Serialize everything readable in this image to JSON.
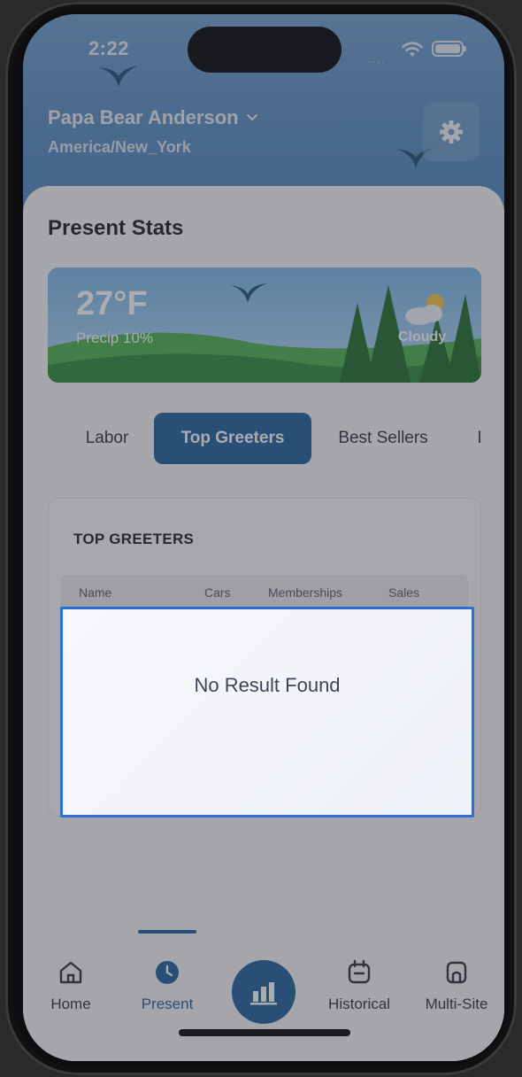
{
  "status_bar": {
    "time": "2:22",
    "dots": "....",
    "icons": [
      "wifi-icon",
      "battery-icon"
    ]
  },
  "header": {
    "user_name": "Papa Bear Anderson",
    "timezone": "America/New_York",
    "settings_icon": "gear-icon"
  },
  "page": {
    "title": "Present Stats"
  },
  "weather": {
    "temperature": "27°F",
    "precip": "Precip 10%",
    "condition": "Cloudy"
  },
  "tabs": [
    {
      "label": "Labor",
      "active": false
    },
    {
      "label": "Top Greeters",
      "active": true
    },
    {
      "label": "Best Sellers",
      "active": false
    },
    {
      "label": "I",
      "active": false
    }
  ],
  "greeters": {
    "title": "TOP GREETERS",
    "columns": [
      "Name",
      "Cars",
      "Memberships",
      "Sales"
    ]
  },
  "modal": {
    "message": "No Result Found"
  },
  "bottom_nav": {
    "items": [
      {
        "label": "Home",
        "icon": "home-icon"
      },
      {
        "label": "Present",
        "icon": "clock-icon",
        "active": true
      },
      {
        "label": "Historical",
        "icon": "calendar-icon"
      },
      {
        "label": "Multi-Site",
        "icon": "store-icon"
      }
    ],
    "center_icon": "bar-chart-icon"
  },
  "colors": {
    "accent": "#1f5f9e",
    "modal_border": "#2f6fd0"
  }
}
